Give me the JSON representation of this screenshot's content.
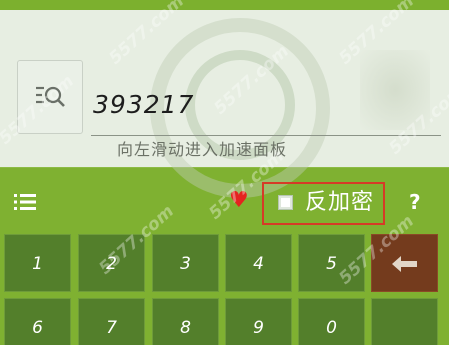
{
  "search": {
    "value": "393217",
    "hint": "向左滑动进入加速面板"
  },
  "toolbar": {
    "reverse_label": "反加密",
    "help_label": "?"
  },
  "keypad": {
    "row1": [
      "1",
      "2",
      "3",
      "4",
      "5"
    ],
    "row2": [
      "6",
      "7",
      "8",
      "9",
      "0"
    ]
  },
  "icons": {
    "search_button": "search-list-icon",
    "menu": "menu-list-icon",
    "favorite": "heart-icon",
    "backspace": "arrow-left-icon",
    "help": "question-icon"
  },
  "colors": {
    "background": "#7fb131",
    "key": "#537f2b",
    "backspace_key": "#743b1d",
    "heart": "#e4231f",
    "highlight_border": "#d63a27"
  },
  "watermark": "5577.com"
}
